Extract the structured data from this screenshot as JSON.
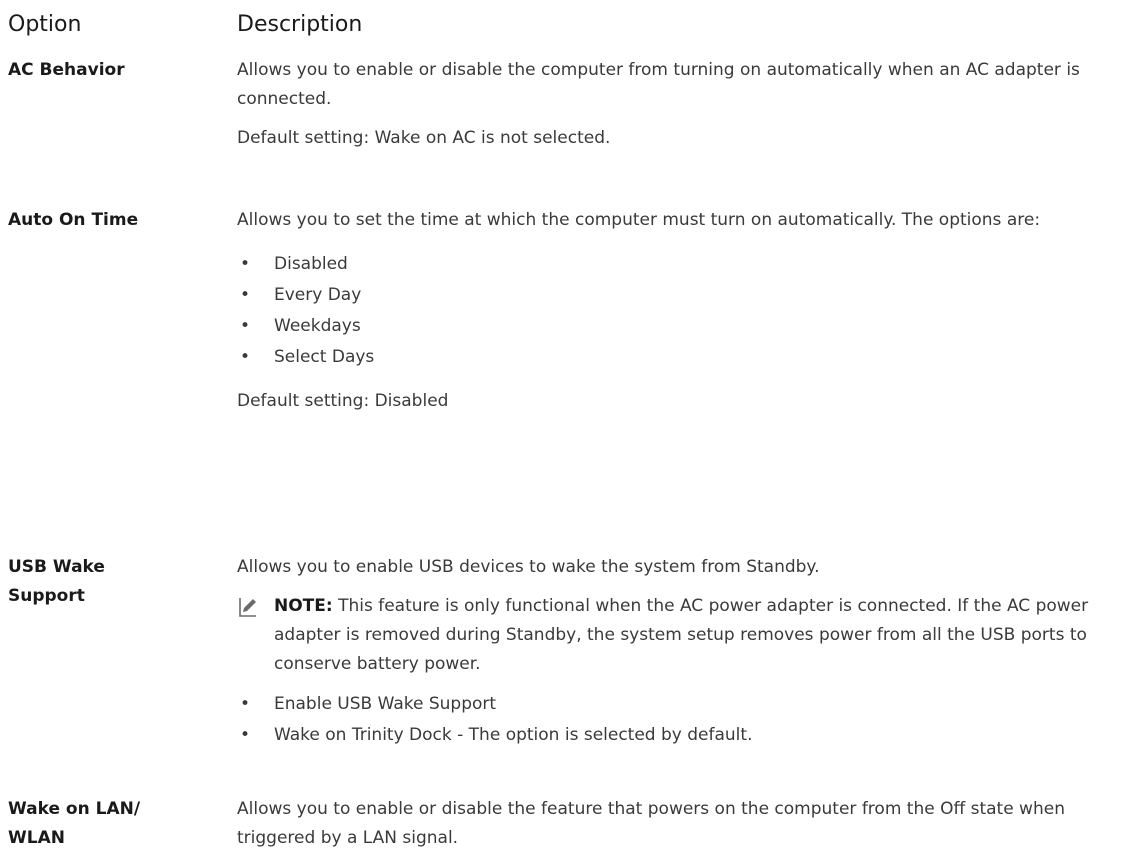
{
  "headers": {
    "option": "Option",
    "description": "Description"
  },
  "rows": [
    {
      "option": "AC Behavior",
      "description": [
        "Allows you to enable or disable the computer from turning on automatically when an AC adapter is connected.",
        "Default setting: Wake on AC is not selected."
      ]
    },
    {
      "option": "Auto On Time",
      "description": [
        "Allows you to set the time at which the computer must turn on automatically. The options are:"
      ],
      "bullets": [
        "Disabled",
        "Every Day",
        "Weekdays",
        "Select Days"
      ],
      "footer": "Default setting: Disabled"
    },
    {
      "option": "USB Wake Support",
      "description": [
        "Allows you to enable USB devices to wake the system from Standby."
      ],
      "note": {
        "label": "NOTE:",
        "text": "This feature is only functional when the AC power adapter is connected. If the AC power adapter is removed during Standby, the system setup removes power from all the USB ports to conserve battery power."
      },
      "bullets": [
        "Enable USB Wake Support",
        "Wake on Trinity Dock - The option is selected by default."
      ]
    },
    {
      "option": "Wake on LAN/ WLAN",
      "description": [
        "Allows you to enable or disable the feature that powers on the computer from the Off state when triggered by a LAN signal."
      ]
    }
  ],
  "bullet_glyph": "•",
  "icons": {
    "note": "pencil-note-icon"
  }
}
